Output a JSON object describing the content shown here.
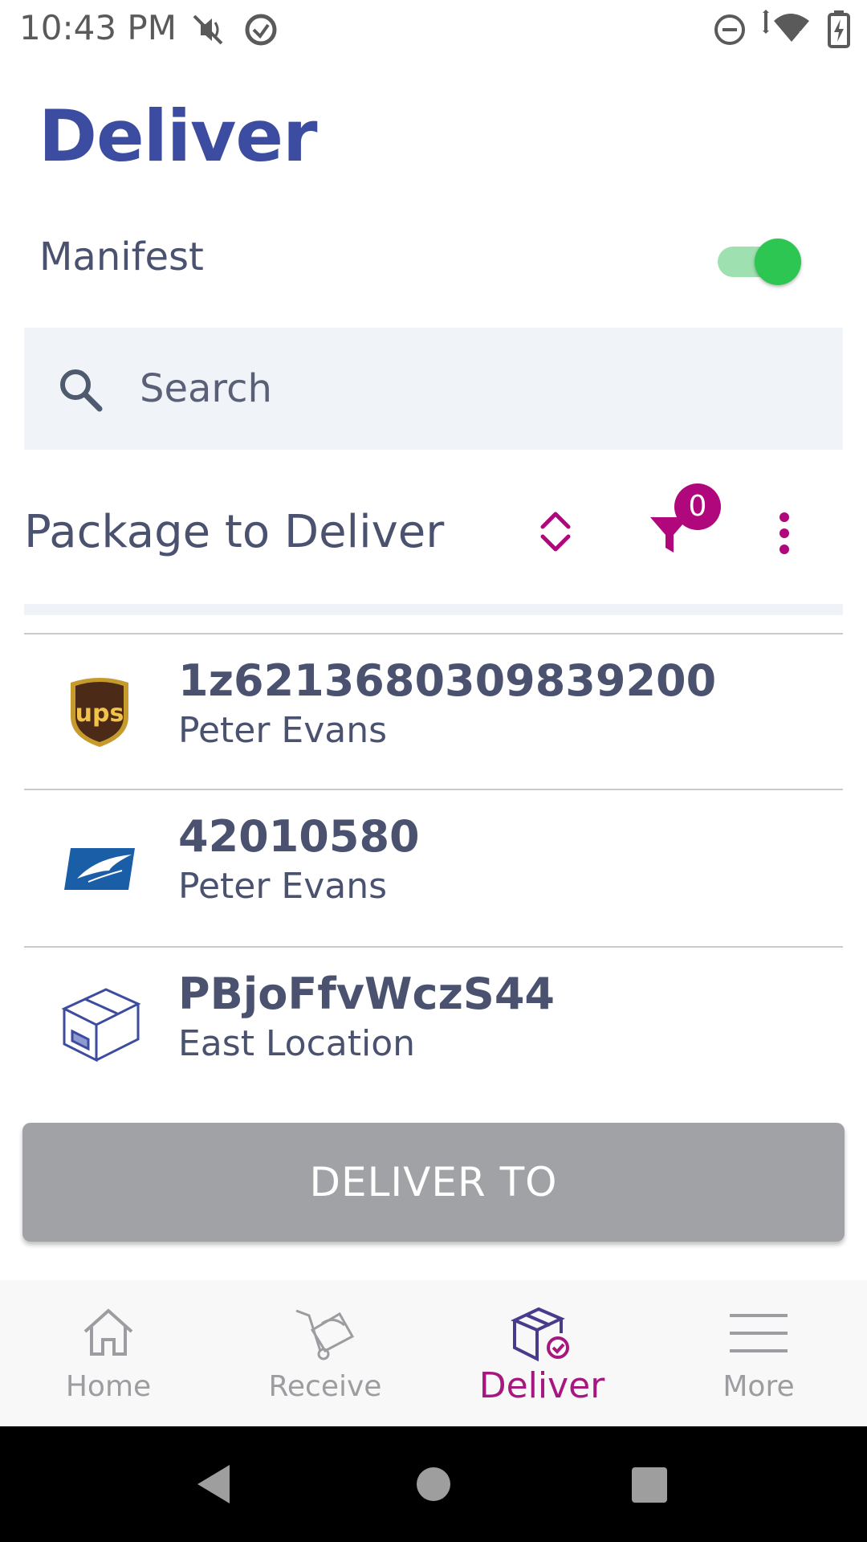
{
  "status_bar": {
    "time": "10:43 PM",
    "icons": [
      "mute-vibrate-icon",
      "sync-icon",
      "do-not-disturb-icon",
      "data-arrows-icon",
      "wifi-icon",
      "battery-charging-icon"
    ]
  },
  "page": {
    "title": "Deliver"
  },
  "manifest": {
    "label": "Manifest",
    "toggle_on": true
  },
  "search": {
    "placeholder": "Search",
    "value": ""
  },
  "section": {
    "title": "Package to Deliver",
    "filter_count": "0"
  },
  "packages": [
    {
      "carrier": "ups-logo",
      "tracking": "1z6213680309839200",
      "recipient": "Peter Evans"
    },
    {
      "carrier": "usps-logo",
      "tracking": "42010580",
      "recipient": "Peter Evans"
    },
    {
      "carrier": "box-icon",
      "tracking": "PBjoFfvWczS44",
      "recipient": "East Location"
    }
  ],
  "actions": {
    "deliver_to_label": "DELIVER TO"
  },
  "bottom_nav": {
    "items": [
      {
        "label": "Home",
        "icon": "home-icon",
        "active": false
      },
      {
        "label": "Receive",
        "icon": "receive-icon",
        "active": false
      },
      {
        "label": "Deliver",
        "icon": "deliver-icon",
        "active": true
      },
      {
        "label": "More",
        "icon": "menu-icon",
        "active": false
      }
    ]
  },
  "colors": {
    "brand_blue": "#3c4ca0",
    "accent_magenta": "#b0077c",
    "toggle_green": "#2dc653",
    "button_disabled": "#a1a2a6"
  }
}
